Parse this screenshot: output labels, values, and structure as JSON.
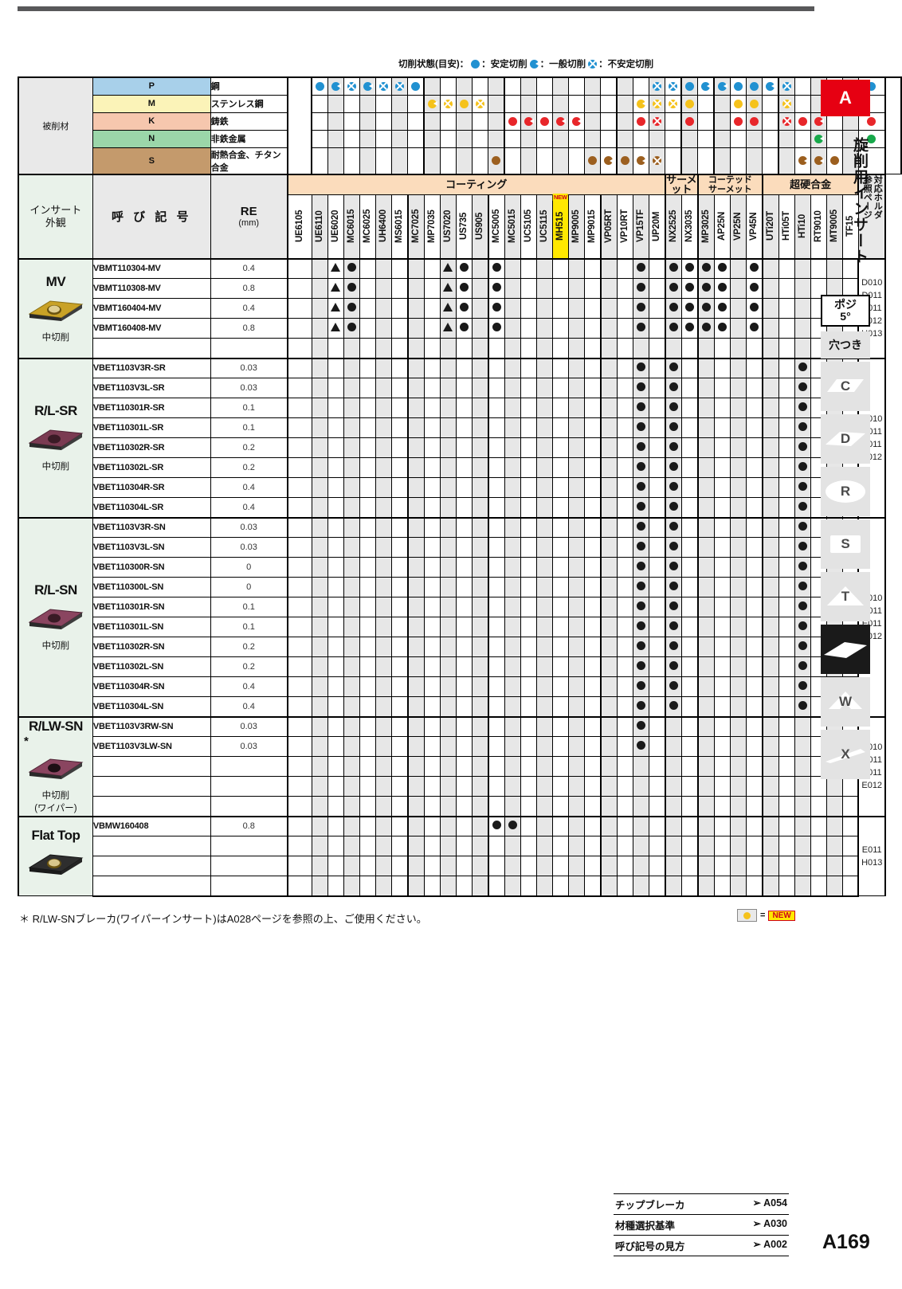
{
  "legend": {
    "title": "切削状態(目安)：",
    "items": [
      {
        "mark": "solid",
        "color": "#2191d1",
        "text": "：安定切削"
      },
      {
        "mark": "pac",
        "color": "#2191d1",
        "text": "：一般切削"
      },
      {
        "mark": "cross",
        "color": "#2191d1",
        "text": "：不安定切削"
      }
    ]
  },
  "workpiece": {
    "label": "被削材",
    "rows": [
      {
        "code": "P",
        "name": "鋼",
        "color": "#a8d0ea"
      },
      {
        "code": "M",
        "name": "ステンレス鋼",
        "color": "#fbf3b8"
      },
      {
        "code": "K",
        "name": "鋳鉄",
        "color": "#f6c7ae"
      },
      {
        "code": "N",
        "name": "非鉄金属",
        "color": "#9bd6a9"
      },
      {
        "code": "S",
        "name": "耐熱合金、チタン合金",
        "color": "#c49a6c"
      }
    ]
  },
  "headers": {
    "appearance": "インサート\n外観",
    "designation": "呼 び 記 号",
    "re": "RE",
    "re_unit": "(mm)",
    "ref_page": "参照ページ",
    "holder": "対応ホルダ",
    "groups": [
      {
        "label": "コーティング",
        "span": 23
      },
      {
        "label": "サーメット",
        "span": 2
      },
      {
        "label": "コーテッド\nサーメット",
        "span": 4
      },
      {
        "label": "超硬合金",
        "span": 6
      }
    ]
  },
  "grades": [
    "UE6105",
    "UE6110",
    "UE6020",
    "MC6015",
    "MC6025",
    "UH6400",
    "MS6015",
    "MC7025",
    "MP7035",
    "US7020",
    "US735",
    "US905",
    "MC5005",
    "MC5015",
    "UC5105",
    "UC5115",
    "MH515",
    "MP9005",
    "MP9015",
    "VP05RT",
    "VP10RT",
    "VP15TF",
    "UP20M",
    "NX2525",
    "NX3035",
    "MP3025",
    "AP25N",
    "VP25N",
    "VP45N",
    "UTi20T",
    "HTi05T",
    "HTi10",
    "RT9010",
    "MT9005",
    "TF15"
  ],
  "new_grade": "MH515",
  "new_label": "NEW",
  "group_boundaries": [
    7,
    12,
    19,
    23,
    25,
    29
  ],
  "condition_marks": {
    "P": [
      {
        "g": "UE6105",
        "m": "solid"
      },
      {
        "g": "UE6110",
        "m": "pac"
      },
      {
        "g": "UE6020",
        "m": "cross"
      },
      {
        "g": "MC6015",
        "m": "pac"
      },
      {
        "g": "MC6025",
        "m": "cross"
      },
      {
        "g": "UH6400",
        "m": "cross"
      },
      {
        "g": "MS6015",
        "m": "solid"
      },
      {
        "g": "VP15TF",
        "m": "cross"
      },
      {
        "g": "UP20M",
        "m": "cross"
      },
      {
        "g": "NX2525",
        "m": "solid"
      },
      {
        "g": "NX3035",
        "m": "pac"
      },
      {
        "g": "MP3025",
        "m": "pac"
      },
      {
        "g": "AP25N",
        "m": "solid"
      },
      {
        "g": "VP25N",
        "m": "solid"
      },
      {
        "g": "VP45N",
        "m": "pac"
      },
      {
        "g": "UTi20T",
        "m": "cross"
      },
      {
        "g": "TF15",
        "m": "solid"
      }
    ],
    "M": [
      {
        "g": "MC7025",
        "m": "pac"
      },
      {
        "g": "MP7035",
        "m": "cross"
      },
      {
        "g": "US7020",
        "m": "solid"
      },
      {
        "g": "US735",
        "m": "cross"
      },
      {
        "g": "VP10RT",
        "m": "pac"
      },
      {
        "g": "VP15TF",
        "m": "cross"
      },
      {
        "g": "UP20M",
        "m": "cross"
      },
      {
        "g": "NX2525",
        "m": "solid"
      },
      {
        "g": "AP25N",
        "m": "solid"
      },
      {
        "g": "VP25N",
        "m": "solid"
      },
      {
        "g": "UTi20T",
        "m": "cross"
      }
    ],
    "K": [
      {
        "g": "MC5005",
        "m": "solid"
      },
      {
        "g": "MC5015",
        "m": "pac"
      },
      {
        "g": "UC5105",
        "m": "solid"
      },
      {
        "g": "UC5115",
        "m": "pac"
      },
      {
        "g": "MH515",
        "m": "pac"
      },
      {
        "g": "VP10RT",
        "m": "solid"
      },
      {
        "g": "VP15TF",
        "m": "cross"
      },
      {
        "g": "NX2525",
        "m": "solid"
      },
      {
        "g": "AP25N",
        "m": "solid"
      },
      {
        "g": "VP25N",
        "m": "solid"
      },
      {
        "g": "UTi20T",
        "m": "cross"
      },
      {
        "g": "HTi05T",
        "m": "solid"
      },
      {
        "g": "HTi10",
        "m": "pac"
      },
      {
        "g": "TF15",
        "m": "solid"
      }
    ],
    "N": [
      {
        "g": "HTi10",
        "m": "pac"
      },
      {
        "g": "TF15",
        "m": "solid"
      }
    ],
    "S": [
      {
        "g": "US905",
        "m": "solid"
      },
      {
        "g": "MP9005",
        "m": "solid"
      },
      {
        "g": "MP9015",
        "m": "pac"
      },
      {
        "g": "VP05RT",
        "m": "solid"
      },
      {
        "g": "VP10RT",
        "m": "pac"
      },
      {
        "g": "VP15TF",
        "m": "cross"
      },
      {
        "g": "HTi05T",
        "m": "pac"
      },
      {
        "g": "HTi10",
        "m": "pac"
      },
      {
        "g": "RT9010",
        "m": "solid"
      }
    ]
  },
  "mark_colors": {
    "P": "#2191d1",
    "M": "#f5c21b",
    "K": "#e8262a",
    "N": "#17a84a",
    "S": "#9c5f1f"
  },
  "sections": [
    {
      "id": "MV",
      "title": "MV",
      "note": "中切削",
      "ref_pages": [
        "D010",
        "D011",
        "E011",
        "E012",
        "H013"
      ],
      "rows": [
        {
          "name": "VBMT110304-MV",
          "re": "0.4",
          "marks": {
            "UE6020": "tri",
            "MC6015": "dot",
            "US7020": "tri",
            "US735": "dot",
            "MC5005": "dot",
            "VP15TF": "dot",
            "NX2525": "dot",
            "NX3035": "dot",
            "MP3025": "dot",
            "AP25N": "dot",
            "VP45N": "dot"
          }
        },
        {
          "name": "VBMT110308-MV",
          "re": "0.8",
          "marks": {
            "UE6020": "tri",
            "MC6015": "dot",
            "US7020": "tri",
            "US735": "dot",
            "MC5005": "dot",
            "VP15TF": "dot",
            "NX2525": "dot",
            "NX3035": "dot",
            "MP3025": "dot",
            "AP25N": "dot",
            "VP45N": "dot"
          }
        },
        {
          "name": "VBMT160404-MV",
          "re": "0.4",
          "marks": {
            "UE6020": "tri",
            "MC6015": "dot",
            "US7020": "tri",
            "US735": "dot",
            "MC5005": "dot",
            "VP15TF": "dot",
            "NX2525": "dot",
            "NX3035": "dot",
            "MP3025": "dot",
            "AP25N": "dot",
            "VP45N": "dot"
          }
        },
        {
          "name": "VBMT160408-MV",
          "re": "0.8",
          "marks": {
            "UE6020": "tri",
            "MC6015": "dot",
            "US7020": "tri",
            "US735": "dot",
            "MC5005": "dot",
            "VP15TF": "dot",
            "NX2525": "dot",
            "NX3035": "dot",
            "MP3025": "dot",
            "AP25N": "dot",
            "VP45N": "dot"
          }
        },
        {
          "name": "",
          "re": "",
          "marks": {}
        }
      ]
    },
    {
      "id": "RL-SR",
      "title": "R/L-SR",
      "note": "中切削",
      "ref_pages": [
        "D010",
        "D011",
        "E011",
        "E012"
      ],
      "rows": [
        {
          "name": "VBET1103V3R-SR",
          "re": "0.03",
          "marks": {
            "VP15TF": "dot",
            "NX2525": "dot",
            "HTi10": "dot"
          }
        },
        {
          "name": "VBET1103V3L-SR",
          "re": "0.03",
          "marks": {
            "VP15TF": "dot",
            "NX2525": "dot",
            "HTi10": "dot"
          }
        },
        {
          "name": "VBET110301R-SR",
          "re": "0.1",
          "marks": {
            "VP15TF": "dot",
            "NX2525": "dot",
            "HTi10": "dot"
          }
        },
        {
          "name": "VBET110301L-SR",
          "re": "0.1",
          "marks": {
            "VP15TF": "dot",
            "NX2525": "dot",
            "HTi10": "dot"
          }
        },
        {
          "name": "VBET110302R-SR",
          "re": "0.2",
          "marks": {
            "VP15TF": "dot",
            "NX2525": "dot",
            "HTi10": "dot"
          }
        },
        {
          "name": "VBET110302L-SR",
          "re": "0.2",
          "marks": {
            "VP15TF": "dot",
            "NX2525": "dot",
            "HTi10": "dot"
          }
        },
        {
          "name": "VBET110304R-SR",
          "re": "0.4",
          "marks": {
            "VP15TF": "dot",
            "NX2525": "dot",
            "HTi10": "dot"
          }
        },
        {
          "name": "VBET110304L-SR",
          "re": "0.4",
          "marks": {
            "VP15TF": "dot",
            "NX2525": "dot",
            "HTi10": "dot"
          }
        }
      ]
    },
    {
      "id": "RL-SN",
      "title": "R/L-SN",
      "note": "中切削",
      "ref_pages": [
        "D010",
        "D011",
        "E011",
        "E012"
      ],
      "rows": [
        {
          "name": "VBET1103V3R-SN",
          "re": "0.03",
          "marks": {
            "VP15TF": "dot",
            "NX2525": "dot",
            "HTi10": "dot"
          }
        },
        {
          "name": "VBET1103V3L-SN",
          "re": "0.03",
          "marks": {
            "VP15TF": "dot",
            "NX2525": "dot",
            "HTi10": "dot"
          }
        },
        {
          "name": "VBET110300R-SN",
          "re": "0",
          "marks": {
            "VP15TF": "dot",
            "NX2525": "dot",
            "HTi10": "dot"
          }
        },
        {
          "name": "VBET110300L-SN",
          "re": "0",
          "marks": {
            "VP15TF": "dot",
            "NX2525": "dot",
            "HTi10": "dot"
          }
        },
        {
          "name": "VBET110301R-SN",
          "re": "0.1",
          "marks": {
            "VP15TF": "dot",
            "NX2525": "dot",
            "HTi10": "dot"
          }
        },
        {
          "name": "VBET110301L-SN",
          "re": "0.1",
          "marks": {
            "VP15TF": "dot",
            "NX2525": "dot",
            "HTi10": "dot"
          }
        },
        {
          "name": "VBET110302R-SN",
          "re": "0.2",
          "marks": {
            "VP15TF": "dot",
            "NX2525": "dot",
            "HTi10": "dot"
          }
        },
        {
          "name": "VBET110302L-SN",
          "re": "0.2",
          "marks": {
            "VP15TF": "dot",
            "NX2525": "dot",
            "HTi10": "dot"
          }
        },
        {
          "name": "VBET110304R-SN",
          "re": "0.4",
          "marks": {
            "VP15TF": "dot",
            "NX2525": "dot",
            "HTi10": "dot"
          }
        },
        {
          "name": "VBET110304L-SN",
          "re": "0.4",
          "marks": {
            "VP15TF": "dot",
            "NX2525": "dot",
            "HTi10": "dot"
          }
        }
      ]
    },
    {
      "id": "RLW-SN",
      "title": "R/LW-SN",
      "title_mark": "*",
      "note": "中切削\n(ワイパー)",
      "ref_pages": [
        "D010",
        "D011",
        "E011",
        "E012"
      ],
      "rows": [
        {
          "name": "VBET1103V3RW-SN",
          "re": "0.03",
          "marks": {
            "VP15TF": "dot"
          }
        },
        {
          "name": "VBET1103V3LW-SN",
          "re": "0.03",
          "marks": {
            "VP15TF": "dot"
          }
        },
        {
          "name": "",
          "re": "",
          "marks": {}
        },
        {
          "name": "",
          "re": "",
          "marks": {}
        },
        {
          "name": "",
          "re": "",
          "marks": {}
        }
      ]
    },
    {
      "id": "FlatTop",
      "title": "Flat Top",
      "note": "",
      "ref_pages": [
        "E011",
        "H013"
      ],
      "rows": [
        {
          "name": "VBMW160408",
          "re": "0.8",
          "marks": {
            "MC5005": "dot",
            "MC5015": "dot"
          }
        },
        {
          "name": "",
          "re": "",
          "marks": {}
        },
        {
          "name": "",
          "re": "",
          "marks": {}
        },
        {
          "name": "",
          "re": "",
          "marks": {}
        }
      ]
    }
  ],
  "footnote": "＊ R/LW-SNブレーカ(ワイパーインサート)はA028ページを参照の上、ご使用ください。",
  "new_legend": {
    "equals": "=",
    "tag": "NEW"
  },
  "sidebar": {
    "tab_letter": "A",
    "vertical_title": "旋削用インサート",
    "posi": "ポジ",
    "posi_angle": "5°",
    "hole": "穴つき",
    "shapes": [
      {
        "label": "C",
        "active": false
      },
      {
        "label": "D",
        "active": false
      },
      {
        "label": "R",
        "active": false
      },
      {
        "label": "S",
        "active": false
      },
      {
        "label": "T",
        "active": false
      },
      {
        "label": "V",
        "active": true
      },
      {
        "label": "W",
        "active": false
      },
      {
        "label": "X",
        "active": false
      }
    ]
  },
  "bottom_refs": [
    {
      "label": "チップブレーカ",
      "page": "➢ A054"
    },
    {
      "label": "材種選択基準",
      "page": "➢ A030"
    },
    {
      "label": "呼び記号の見方",
      "page": "➢ A002"
    }
  ],
  "page_number": "A169"
}
